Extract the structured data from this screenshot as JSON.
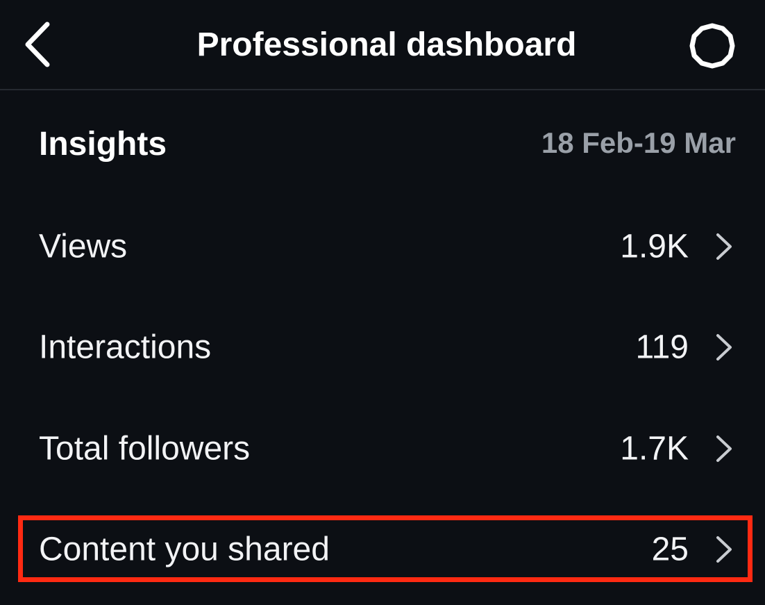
{
  "header": {
    "title": "Professional dashboard",
    "back_icon": "chevron-left-icon",
    "settings_icon": "gear-icon"
  },
  "insights": {
    "label": "Insights",
    "date_range": "18 Feb-19 Mar"
  },
  "metrics": [
    {
      "label": "Views",
      "value": "1.9K"
    },
    {
      "label": "Interactions",
      "value": "119"
    },
    {
      "label": "Total followers",
      "value": "1.7K"
    },
    {
      "label": "Content you shared",
      "value": "25"
    }
  ],
  "colors": {
    "background": "#0c0f14",
    "text": "#ffffff",
    "muted_text": "#9aa0a8",
    "highlight": "#ff2a12"
  }
}
